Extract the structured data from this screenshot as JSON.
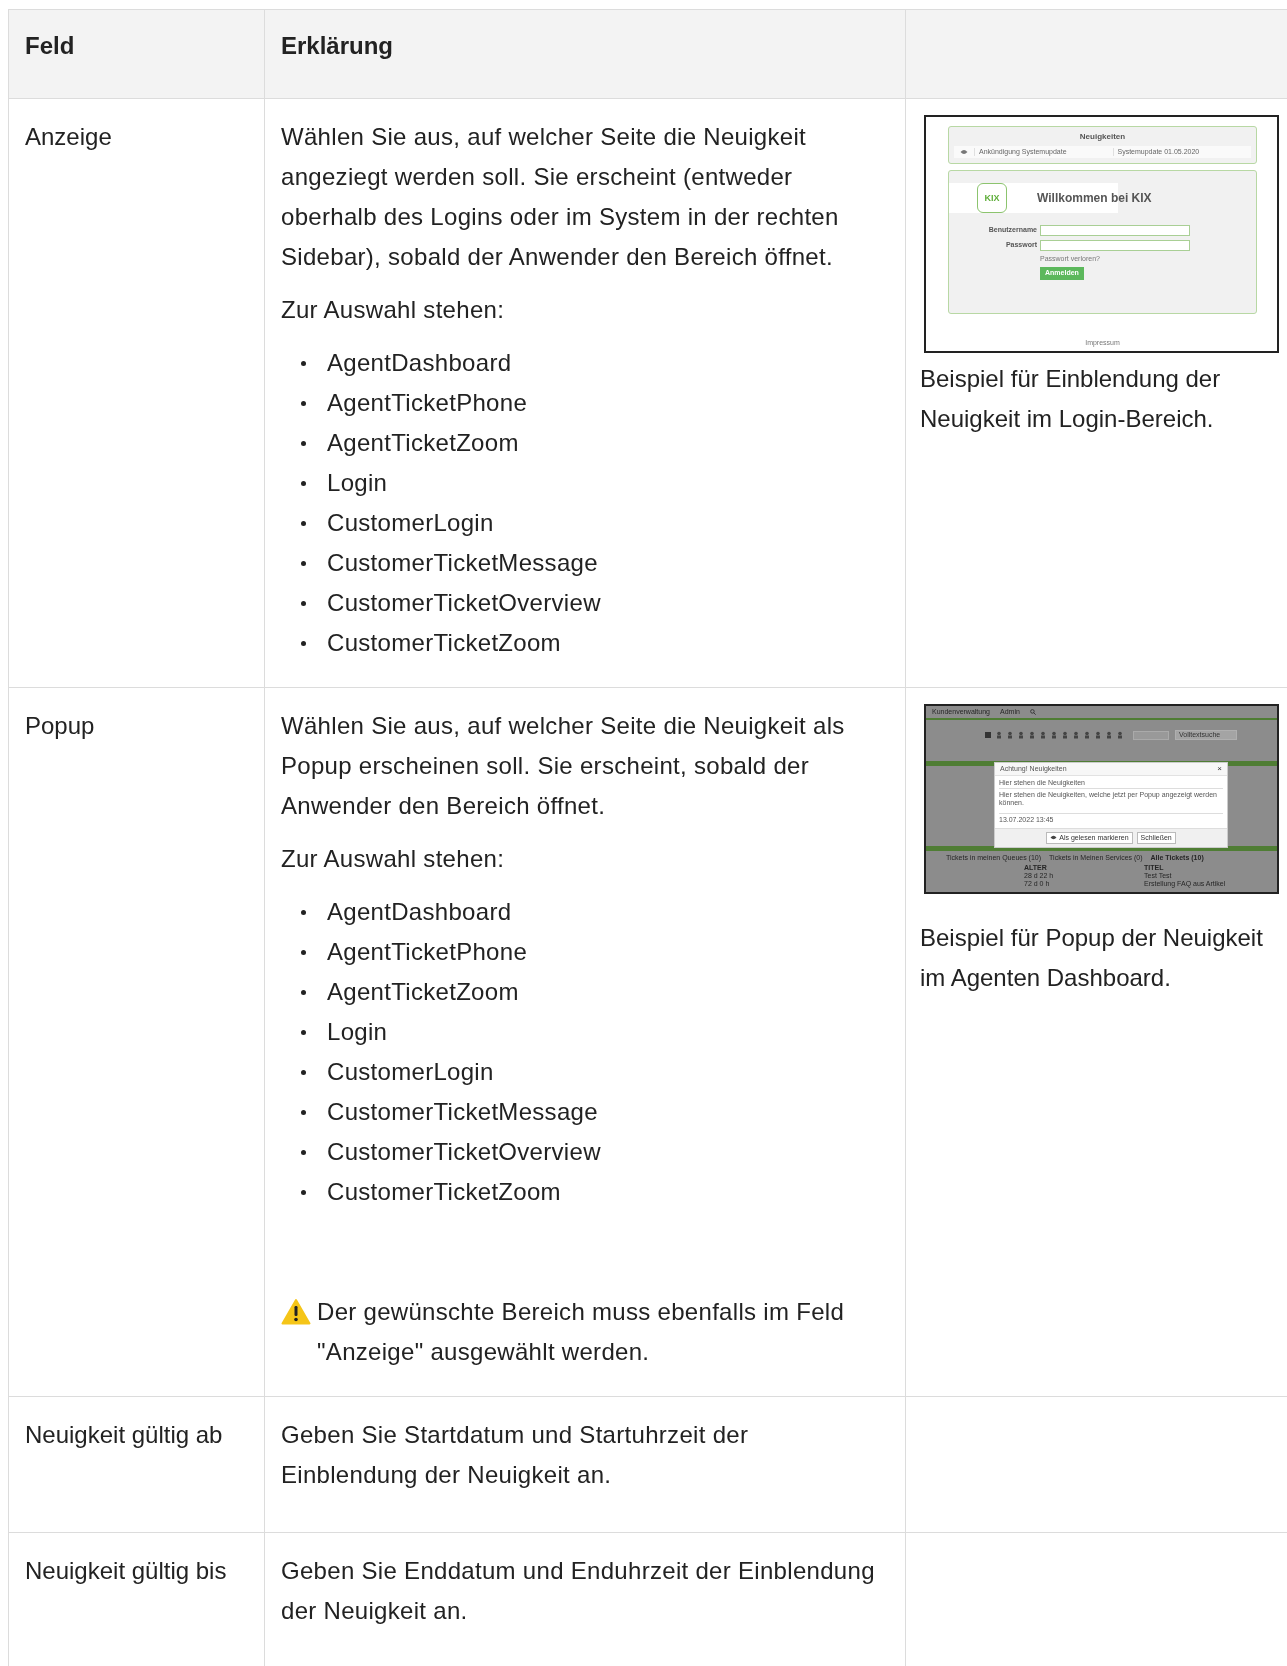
{
  "table": {
    "columns": [
      "Feld",
      "Erklärung"
    ],
    "rows": [
      {
        "field": "Anzeige",
        "paragraphs": [
          "Wählen Sie aus, auf welcher Seite die Neuigkeit angeziegt werden soll. Sie erscheint (entweder oberhalb des Logins oder im System in der rechten Sidebar), sobald der Anwender den Bereich öffnet.",
          "Zur Auswahl stehen:"
        ],
        "options": [
          "AgentDashboard",
          "AgentTicketPhone",
          "AgentTicketZoom",
          "Login",
          "CustomerLogin",
          "CustomerTicketMessage",
          "CustomerTicketOverview",
          "CustomerTicketZoom"
        ],
        "example": {
          "kind": "login",
          "caption": "Beispiel für Einblendung der Neuigkeit im Login-Bereich.",
          "screen": {
            "news_title": "Neuigkeiten",
            "news_item": "Ankündigung Systemupdate",
            "news_text": "Systemupdate 01.05.2020",
            "logo": "KIX",
            "title": "Willkommen bei KIX",
            "username_label": "Benutzername",
            "password_label": "Passwort",
            "lost_password": "Passwort verloren?",
            "login_button": "Anmelden",
            "footer": "Impressum"
          }
        }
      },
      {
        "field": "Popup",
        "paragraphs": [
          "Wählen Sie aus, auf welcher Seite die Neuigkeit als Popup erscheinen soll. Sie erscheint, sobald der Anwender den Bereich öffnet.",
          "Zur Auswahl stehen:"
        ],
        "options": [
          "AgentDashboard",
          "AgentTicketPhone",
          "AgentTicketZoom",
          "Login",
          "CustomerLogin",
          "CustomerTicketMessage",
          "CustomerTicketOverview",
          "CustomerTicketZoom"
        ],
        "note": "Der gewünschte Bereich muss ebenfalls im Feld \"Anzeige\" ausgewählt werden.",
        "example": {
          "kind": "popup",
          "caption": "Beispiel für Popup der Neuigkeit im Agenten Dashboard.",
          "screen": {
            "menu": [
              "Kundenverwaltung",
              "Admin"
            ],
            "search_placeholder": "Volltextsuche",
            "dialog_title": "Achtung! Neuigkeiten",
            "close": "×",
            "news_title": "Hier stehen die Neuigkeiten",
            "news_text": "Hier stehen die Neuigkeiten, welche jetzt per Popup angezeigt werden können.",
            "date": "13.07.2022 13:45",
            "read_button": "Als gelesen markieren",
            "close_button": "Schließen",
            "tabs": [
              "Tickets in meinen Queues (10)",
              "Tickets in Meinen Services (0)",
              "Alle Tickets (10)"
            ],
            "columns": [
              "ALTER",
              "TITEL"
            ],
            "rows": [
              [
                "28 d 22 h",
                "Test Test"
              ],
              [
                "72 d 0 h",
                "Erstellung FAQ aus Artikel"
              ]
            ]
          }
        }
      },
      {
        "field": "Neuigkeit gültig ab",
        "paragraphs": [
          "Geben Sie Startdatum und Startuhrzeit der Einblendung der Neuigkeit an."
        ]
      },
      {
        "field": "Neuigkeit gültig bis",
        "paragraphs": [
          "Geben Sie Enddatum und Enduhrzeit der Einblendung der Neuigkeit an."
        ]
      }
    ]
  }
}
